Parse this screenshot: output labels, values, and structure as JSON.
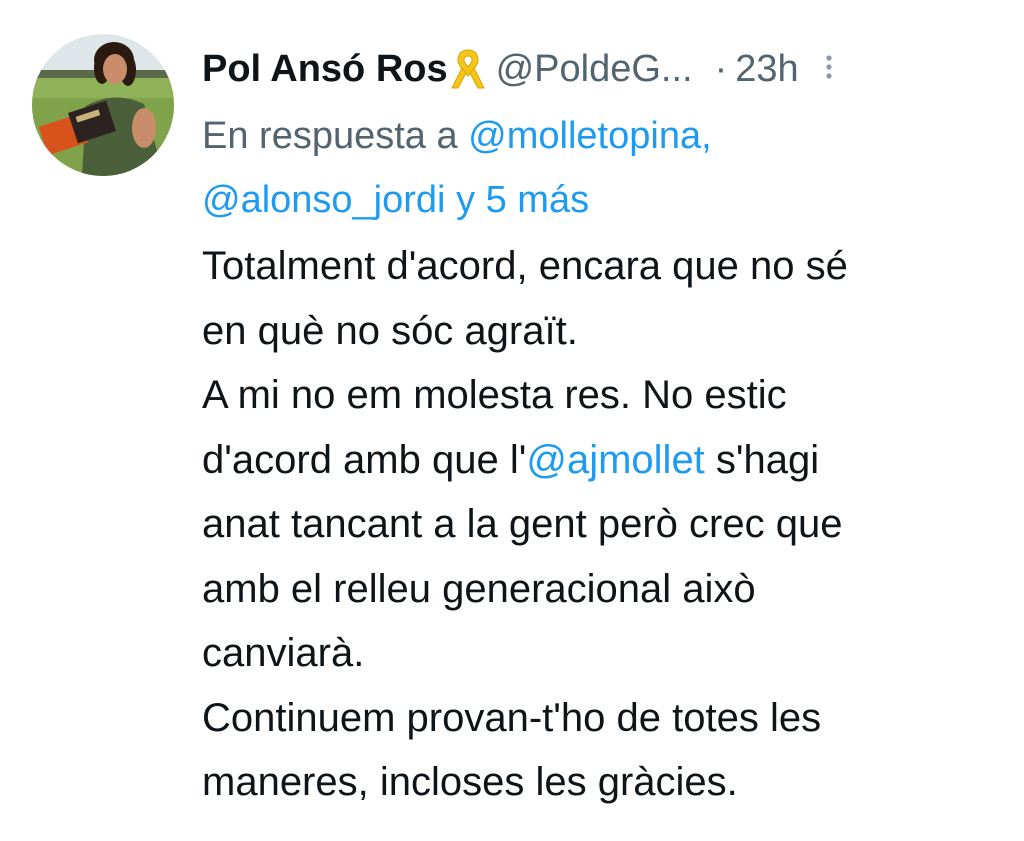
{
  "tweet": {
    "author": {
      "name": "Pol Ansó Ros",
      "handle": "@PoldeG...",
      "badge_icon": "yellow-ribbon-icon"
    },
    "separator": "·",
    "time": "23h",
    "reply_prefix": "En respuesta a",
    "reply_mention_1": "@molletopina,",
    "reply_mention_2": "@alonso_jordi",
    "reply_suffix": "y 5 más",
    "body": {
      "line1": "Totalment d'acord, encara que no sé",
      "line2": "en què no sóc agraït.",
      "line3": "A mi no em molesta res. No estic",
      "line4_before": "d'acord amb que l'",
      "line4_mention": "@ajmollet",
      "line4_after": " s'hagi",
      "line5": "anat tancant a la gent però crec que",
      "line6": "amb el relleu generacional això",
      "line7": "canviarà.",
      "line8": "Continuem provan-t'ho de totes les",
      "line9": "maneres, incloses les gràcies."
    },
    "colors": {
      "text": "#0f1419",
      "secondary": "#536471",
      "link": "#1d9bf0",
      "ribbon": "#f5c518"
    }
  }
}
